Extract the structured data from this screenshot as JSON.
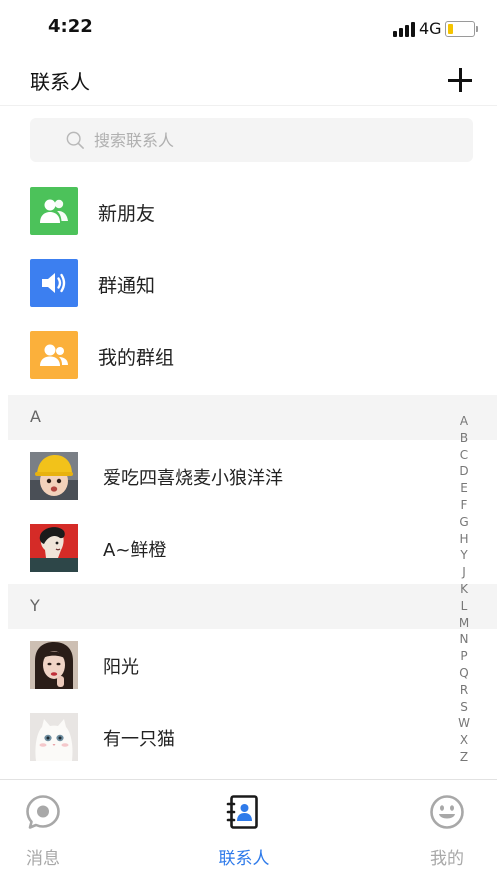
{
  "status_bar": {
    "time": "4:22",
    "network": "4G",
    "battery_level": 0.2,
    "battery_color": "#f5c400"
  },
  "header": {
    "title": "联系人",
    "add_icon": "plus-icon"
  },
  "search": {
    "placeholder": "搜索联系人",
    "icon": "search-icon"
  },
  "functions": [
    {
      "label": "新朋友",
      "icon": "new-friend-icon",
      "color": "#4cc25a"
    },
    {
      "label": "群通知",
      "icon": "speaker-icon",
      "color": "#3c7ff0"
    },
    {
      "label": "我的群组",
      "icon": "group-icon",
      "color": "#fbb03b"
    }
  ],
  "sections": [
    {
      "letter": "A",
      "contacts": [
        {
          "name": "爱吃四喜烧麦小狼洋洋",
          "avatar": "avatar-girl-yellow-hat"
        },
        {
          "name": "A~鲜橙",
          "avatar": "avatar-red-profile"
        }
      ]
    },
    {
      "letter": "Y",
      "contacts": [
        {
          "name": "阳光",
          "avatar": "avatar-woman-portrait"
        },
        {
          "name": "有一只猫",
          "avatar": "avatar-white-cat"
        }
      ]
    }
  ],
  "index_letters": [
    "A",
    "B",
    "C",
    "D",
    "E",
    "F",
    "G",
    "H",
    "Y",
    "J",
    "K",
    "L",
    "M",
    "N",
    "P",
    "Q",
    "R",
    "S",
    "W",
    "X",
    "Z"
  ],
  "tabs": [
    {
      "label": "消息",
      "icon": "message-bubble-icon",
      "active": false
    },
    {
      "label": "联系人",
      "icon": "contacts-book-icon",
      "active": true
    },
    {
      "label": "我的",
      "icon": "smiley-icon",
      "active": false
    }
  ],
  "colors": {
    "accent": "#2f7bea",
    "inactive": "#a8a8a8"
  }
}
